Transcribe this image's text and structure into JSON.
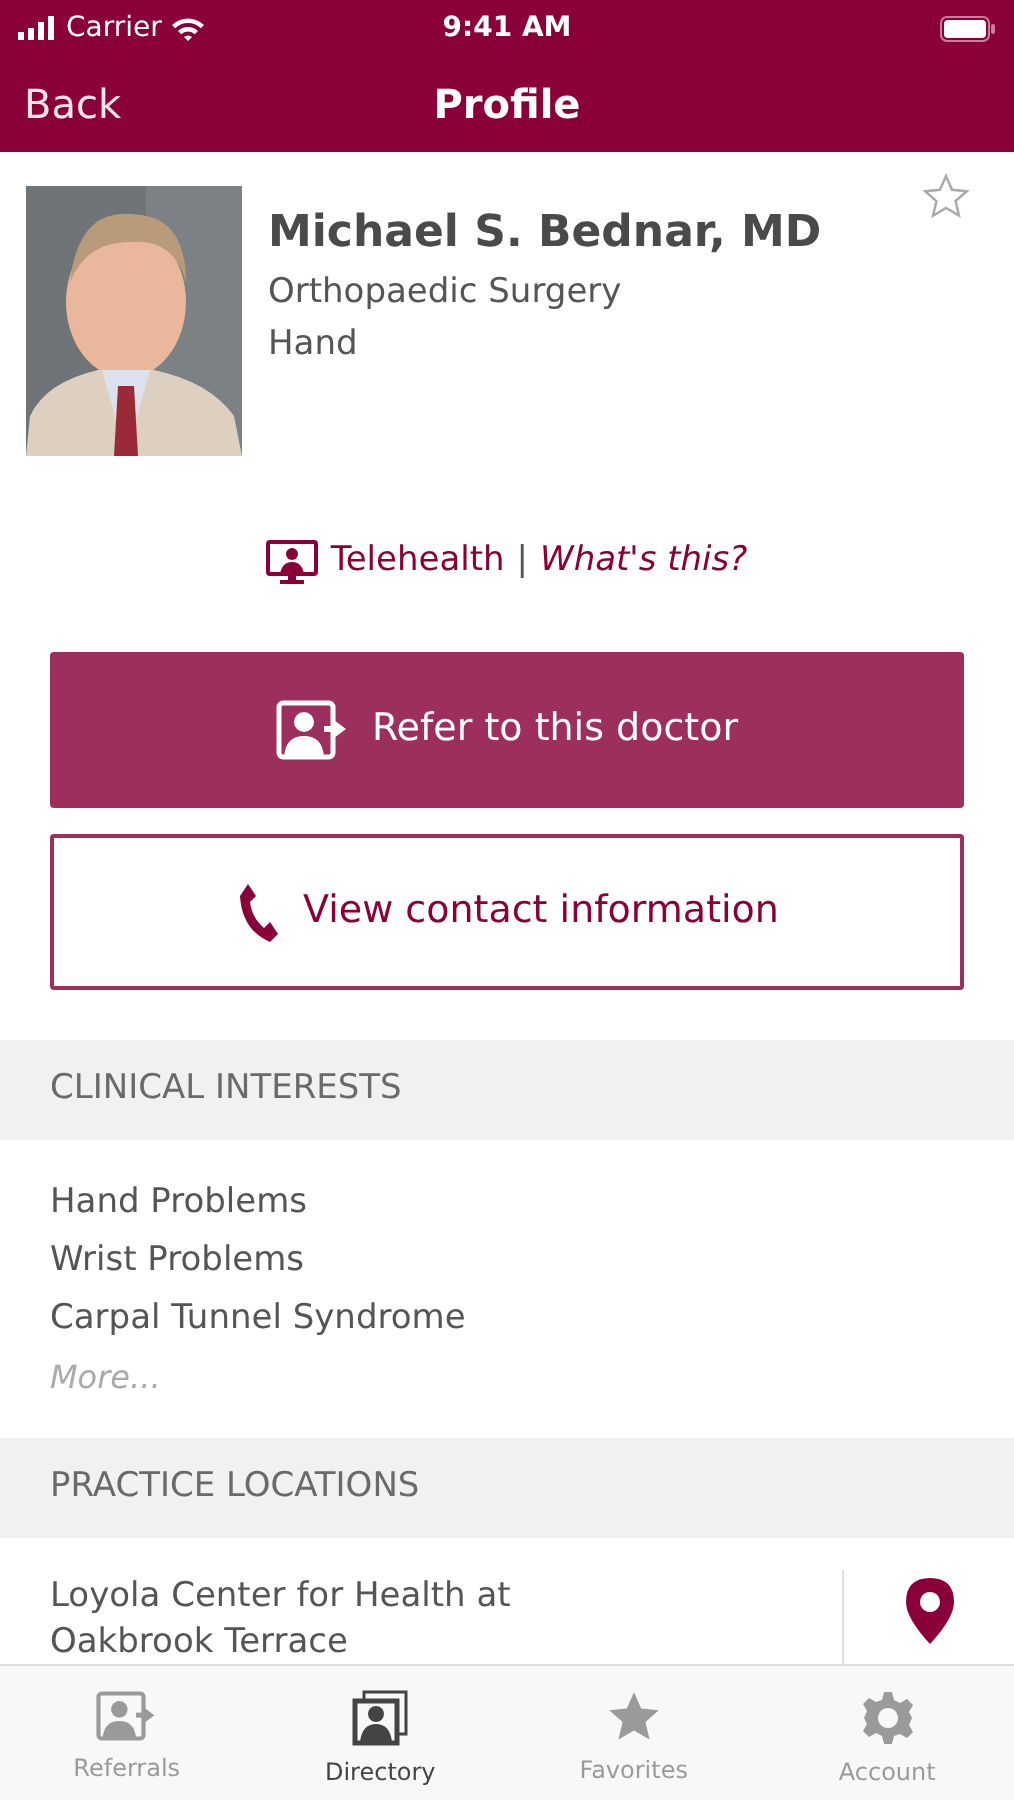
{
  "status_bar": {
    "carrier": "Carrier",
    "time": "9:41 AM"
  },
  "nav": {
    "back": "Back",
    "title": "Profile"
  },
  "doctor": {
    "name": "Michael S. Bednar, MD",
    "specialty": "Orthopaedic Surgery",
    "subspecialty": "Hand",
    "favorite": false
  },
  "telehealth": {
    "label": "Telehealth",
    "separator": "|",
    "link": "What's this?"
  },
  "actions": [
    {
      "kind": "primary",
      "label": "Refer to this doctor"
    },
    {
      "kind": "secondary",
      "label": "View contact information"
    }
  ],
  "clinical_interests": {
    "title": "CLINICAL INTERESTS",
    "items": [
      "Hand Problems",
      "Wrist Problems",
      "Carpal Tunnel Syndrome"
    ],
    "more": "More..."
  },
  "practice_locations": {
    "title": "PRACTICE LOCATIONS",
    "items": [
      {
        "name": "Loyola Center for Health at Oakbrook Terrace"
      }
    ]
  },
  "tab_bar": [
    {
      "label": "Referrals",
      "kind": "referrals",
      "selected": false
    },
    {
      "label": "Directory",
      "kind": "directory",
      "selected": true
    },
    {
      "label": "Favorites",
      "kind": "favorites",
      "selected": false
    },
    {
      "label": "Account",
      "kind": "account",
      "selected": false
    }
  ]
}
